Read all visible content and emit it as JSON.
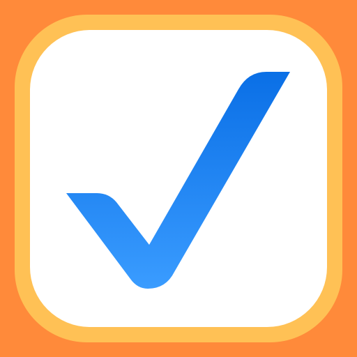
{
  "icon": {
    "name": "checkmark-icon",
    "colors": {
      "background": "#ff8a3a",
      "ring": "#ffc155",
      "card": "#ffffff",
      "check_top": "#0a6fe6",
      "check_bottom": "#3a9cff"
    }
  }
}
